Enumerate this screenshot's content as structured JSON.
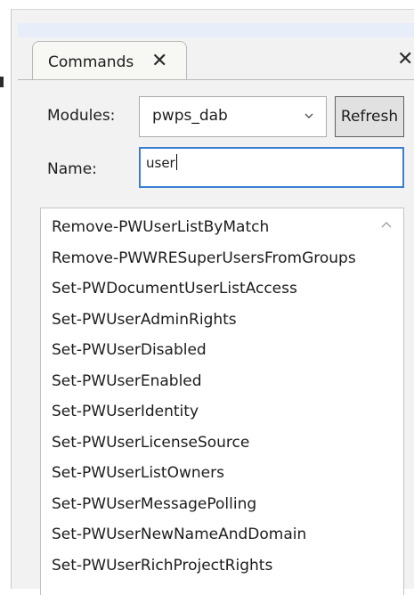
{
  "tab": {
    "label": "Commands",
    "close_glyph": "✕"
  },
  "pane": {
    "close_glyph": "✕"
  },
  "filters": {
    "modules_label": "Modules:",
    "module_value": "pwps_dab",
    "refresh_label": "Refresh",
    "name_label": "Name:",
    "name_value": "user"
  },
  "commands": [
    "Remove-PWUserListByMatch",
    "Remove-PWWRESuperUsersFromGroups",
    "Set-PWDocumentUserListAccess",
    "Set-PWUserAdminRights",
    "Set-PWUserDisabled",
    "Set-PWUserEnabled",
    "Set-PWUserIdentity",
    "Set-PWUserLicenseSource",
    "Set-PWUserListOwners",
    "Set-PWUserMessagePolling",
    "Set-PWUserNewNameAndDomain",
    "Set-PWUserRichProjectRights"
  ],
  "icons": {
    "dropdown": "chevron-down-icon",
    "scroll": "chevron-up-icon"
  }
}
